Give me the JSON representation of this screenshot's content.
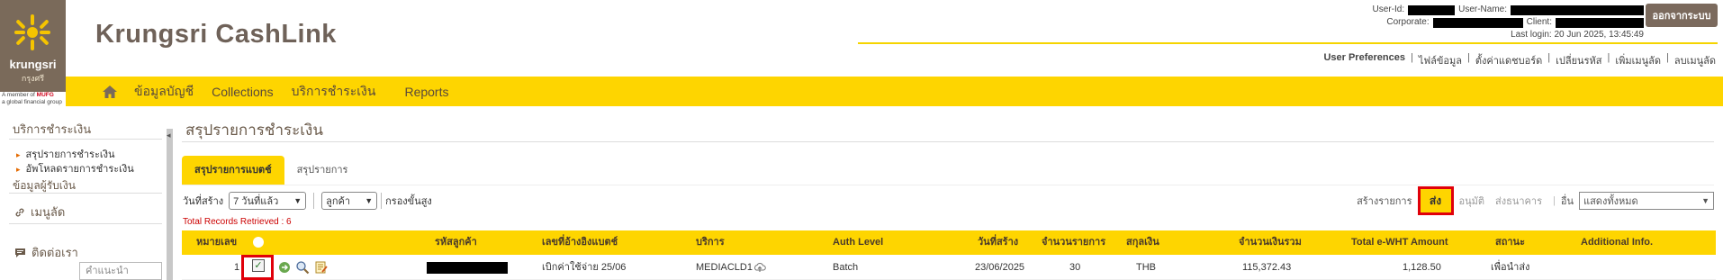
{
  "header": {
    "logo_brand": "krungsri",
    "logo_thai": "กรุงศรี",
    "mufg_line1": "A member of",
    "mufg_brand": "MUFG",
    "mufg_line2": "a global financial group",
    "app_title": "Krungsri CashLink",
    "user_id_label": "User-Id:",
    "user_name_label": "User-Name:",
    "corporate_label": "Corporate:",
    "client_label": "Client:",
    "last_login": "Last login: 20 Jun 2025, 13:45:49",
    "logout_label": "ออกจากระบบ"
  },
  "top_links": {
    "preferences": "User Preferences",
    "profile": "ไฟล์ข้อมูล",
    "dashboard": "ตั้งค่าแดชบอร์ด",
    "change_password": "เปลี่ยนรหัส",
    "add_shortcut": "เพิ่มเมนูลัด",
    "delete_shortcut": "ลบเมนูลัด"
  },
  "nav": {
    "accounts": "ข้อมูลบัญชี",
    "collections": "Collections",
    "payments": "บริการชำระเงิน",
    "reports": "Reports"
  },
  "sidebar": {
    "title": "บริการชำระเงิน",
    "items": [
      "สรุปรายการชำระเงิน",
      "อัพโหลดรายการชำระเงิน"
    ],
    "beneficiary": "ข้อมูลผู้รับเงิน",
    "shortcuts": "เมนูลัด",
    "contact": "ติดต่อเรา",
    "select_placeholder": "คำแนะนำ"
  },
  "main": {
    "page_title": "สรุปรายการชำระเงิน",
    "tabs": [
      "สรุปรายการแบตช์",
      "สรุปรายการ"
    ],
    "filter": {
      "created_label": "วันที่สร้าง",
      "created_value": "7 วันที่แล้ว",
      "customer_value": "ลูกค้า",
      "advanced": "กรองขั้นสูง"
    },
    "actions": {
      "create_label": "สร้างรายการ",
      "send": "ส่ง",
      "approve": "อนุมัติ",
      "send_bank": "ส่งธนาคาร",
      "other": "อื่น",
      "show_all": "แสดงทั้งหมด"
    },
    "records": "Total Records Retrieved : 6"
  },
  "table": {
    "headers": {
      "number": "หมายเลข",
      "customer_code": "รหัสลูกค้า",
      "batch_ref": "เลขที่อ้างอิงแบตช์",
      "service": "บริการ",
      "auth_level": "Auth Level",
      "created_date": "วันที่สร้าง",
      "count": "จำนวนรายการ",
      "currency": "สกุลเงิน",
      "total_amount": "จำนวนเงินรวม",
      "wht_amount": "Total e-WHT Amount",
      "status": "สถานะ",
      "additional": "Additional Info."
    },
    "rows": [
      {
        "number": "1",
        "batch_ref": "เบิกค่าใช้จ่าย 25/06",
        "service": "MEDIACLD1",
        "auth_level": "Batch",
        "created_date": "23/06/2025",
        "count": "30",
        "currency": "THB",
        "total_amount": "115,372.43",
        "wht_amount": "1,128.50",
        "status": "เพื่อนำส่ง"
      }
    ]
  },
  "colors": {
    "brand_yellow": "#fed500",
    "brand_brown": "#7a6a5a",
    "highlight_red": "#e0000a"
  }
}
